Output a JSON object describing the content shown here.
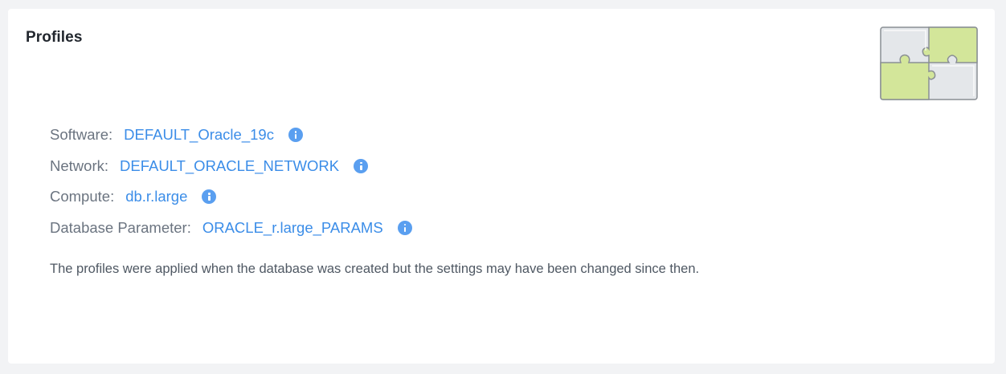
{
  "card": {
    "title": "Profiles",
    "illustration": "puzzle-pieces-icon"
  },
  "profiles": [
    {
      "label": "Software:",
      "value": "DEFAULT_Oracle_19c",
      "icon": "info-icon"
    },
    {
      "label": "Network:",
      "value": "DEFAULT_ORACLE_NETWORK",
      "icon": "info-icon"
    },
    {
      "label": "Compute:",
      "value": "db.r.large",
      "icon": "info-icon"
    },
    {
      "label": "Database Parameter:",
      "value": "ORACLE_r.large_PARAMS",
      "icon": "info-icon"
    }
  ],
  "note": "The profiles were applied when the database was created but the settings may have been changed since then.",
  "colors": {
    "link": "#3b8de8",
    "info_icon": "#5a9ff0",
    "puzzle_green": "#d3e69a",
    "puzzle_gray": "#e4e7ea"
  }
}
